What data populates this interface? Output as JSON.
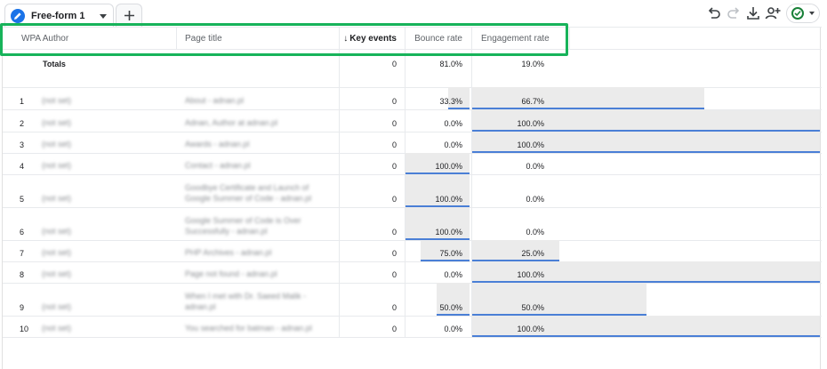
{
  "tab": {
    "label": "Free-form 1",
    "icon": "pencil-icon",
    "accent": "#1a73e8"
  },
  "toolbar": {
    "icons": [
      "undo-icon",
      "redo-icon",
      "download-icon",
      "share-user-icon",
      "status-check-icon"
    ]
  },
  "table": {
    "headers": {
      "author": "WPA Author",
      "page_title": "Page title",
      "key_events": "Key events",
      "bounce_rate": "Bounce rate",
      "engagement_rate": "Engagement rate"
    },
    "sort_arrow": "↓",
    "totals": {
      "label": "Totals",
      "key_events": "0",
      "bounce_rate": "81.0%",
      "engagement_rate": "19.0%"
    },
    "rows": [
      {
        "index": "1",
        "author": "(not set)",
        "title": "About - adnan.pl",
        "key_events": "0",
        "bounce_rate": "33.3%",
        "engagement_rate": "66.7%",
        "bounce_frac": 0.333,
        "engage_frac": 0.667
      },
      {
        "index": "2",
        "author": "(not set)",
        "title": "Adnan, Author at adnan.pl",
        "key_events": "0",
        "bounce_rate": "0.0%",
        "engagement_rate": "100.0%",
        "bounce_frac": 0.0,
        "engage_frac": 1.0
      },
      {
        "index": "3",
        "author": "(not set)",
        "title": "Awards - adnan.pl",
        "key_events": "0",
        "bounce_rate": "0.0%",
        "engagement_rate": "100.0%",
        "bounce_frac": 0.0,
        "engage_frac": 1.0
      },
      {
        "index": "4",
        "author": "(not set)",
        "title": "Contact - adnan.pl",
        "key_events": "0",
        "bounce_rate": "100.0%",
        "engagement_rate": "0.0%",
        "bounce_frac": 1.0,
        "engage_frac": 0.0
      },
      {
        "index": "5",
        "author": "(not set)",
        "title": "Goodbye Certificate and Launch of Google Summer of Code - adnan.pl",
        "key_events": "0",
        "bounce_rate": "100.0%",
        "engagement_rate": "0.0%",
        "bounce_frac": 1.0,
        "engage_frac": 0.0
      },
      {
        "index": "6",
        "author": "(not set)",
        "title": "Google Summer of Code is Over Successfully - adnan.pl",
        "key_events": "0",
        "bounce_rate": "100.0%",
        "engagement_rate": "0.0%",
        "bounce_frac": 1.0,
        "engage_frac": 0.0
      },
      {
        "index": "7",
        "author": "(not set)",
        "title": "PHP Archives - adnan.pl",
        "key_events": "0",
        "bounce_rate": "75.0%",
        "engagement_rate": "25.0%",
        "bounce_frac": 0.75,
        "engage_frac": 0.25
      },
      {
        "index": "8",
        "author": "(not set)",
        "title": "Page not found - adnan.pl",
        "key_events": "0",
        "bounce_rate": "0.0%",
        "engagement_rate": "100.0%",
        "bounce_frac": 0.0,
        "engage_frac": 1.0
      },
      {
        "index": "9",
        "author": "(not set)",
        "title": "When I met with Dr. Saeed Malik - adnan.pl",
        "key_events": "0",
        "bounce_rate": "50.0%",
        "engagement_rate": "50.0%",
        "bounce_frac": 0.5,
        "engage_frac": 0.5
      },
      {
        "index": "10",
        "author": "(not set)",
        "title": "You searched for batman - adnan.pl",
        "key_events": "0",
        "bounce_rate": "0.0%",
        "engagement_rate": "100.0%",
        "bounce_frac": 0.0,
        "engage_frac": 1.0
      }
    ]
  },
  "colors": {
    "highlight": "#17b35a",
    "bar_bg": "#ebebeb",
    "bar_line": "#4a7fd6"
  }
}
